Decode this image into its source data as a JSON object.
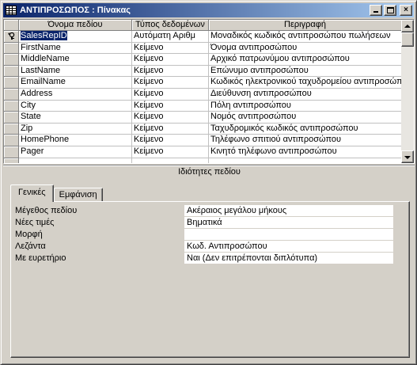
{
  "window": {
    "title": "ΑΝΤΙΠΡΟΣΩΠΟΣ : Πίνακας",
    "min_label": "_",
    "close_label": "×"
  },
  "grid": {
    "headers": [
      "Όνομα πεδίου",
      "Τύπος δεδομένων",
      "Περιγραφή"
    ],
    "rows": [
      {
        "name": "SalesRepID",
        "type": "Αυτόματη Αριθμ",
        "desc": "Μοναδικός κωδικός αντιπροσώπου πωλήσεων",
        "primary_key": true
      },
      {
        "name": "FirstName",
        "type": "Κείμενο",
        "desc": "Όνομα αντιπροσώπου"
      },
      {
        "name": "MiddleName",
        "type": "Κείμενο",
        "desc": "Αρχικό πατρωνύμου αντιπροσώπου"
      },
      {
        "name": "LastName",
        "type": "Κείμενο",
        "desc": "Επώνυμο αντιπροσώπου"
      },
      {
        "name": "EmailName",
        "type": "Κείμενο",
        "desc": "Κωδικός ηλεκτρονικού ταχυδρομείου αντιπροσώπου"
      },
      {
        "name": "Address",
        "type": "Κείμενο",
        "desc": "Διεύθυνση αντιπροσώπου"
      },
      {
        "name": "City",
        "type": "Κείμενο",
        "desc": "Πόλη αντιπροσώπου"
      },
      {
        "name": "State",
        "type": "Κείμενο",
        "desc": "Νομός αντιπροσώπου"
      },
      {
        "name": "Zip",
        "type": "Κείμενο",
        "desc": "Ταχυδρομικός κωδικός αντιπροσώπου"
      },
      {
        "name": "HomePhone",
        "type": "Κείμενο",
        "desc": "Τηλέφωνο σπιτιού αντιπροσώπου"
      },
      {
        "name": "Pager",
        "type": "Κείμενο",
        "desc": "Κινητό τηλέφωνο αντιπροσώπου"
      },
      {
        "name": "",
        "type": "",
        "desc": ""
      }
    ]
  },
  "properties": {
    "title": "Ιδιότητες πεδίου",
    "tabs": [
      "Γενικές",
      "Εμφάνιση"
    ],
    "active_tab": "Γενικές",
    "items": [
      {
        "label": "Μέγεθος πεδίου",
        "value": "Ακέραιος μεγάλου μήκους"
      },
      {
        "label": "Νέες τιμές",
        "value": "Βηματικά"
      },
      {
        "label": "Μορφή",
        "value": ""
      },
      {
        "label": "Λεζάντα",
        "value": "Κωδ. Αντιπροσώπου"
      },
      {
        "label": "Με ευρετήριο",
        "value": "Ναι (Δεν επιτρέπονται διπλότυπα)"
      }
    ]
  },
  "colors": {
    "titlebar_start": "#0a246a",
    "titlebar_end": "#a6caf0",
    "face": "#d4d0c8",
    "selection": "#0a246a"
  },
  "icons": [
    "table-icon",
    "primary-key-icon",
    "minimize-icon",
    "maximize-icon",
    "close-icon",
    "scroll-up-icon",
    "scroll-down-icon"
  ]
}
